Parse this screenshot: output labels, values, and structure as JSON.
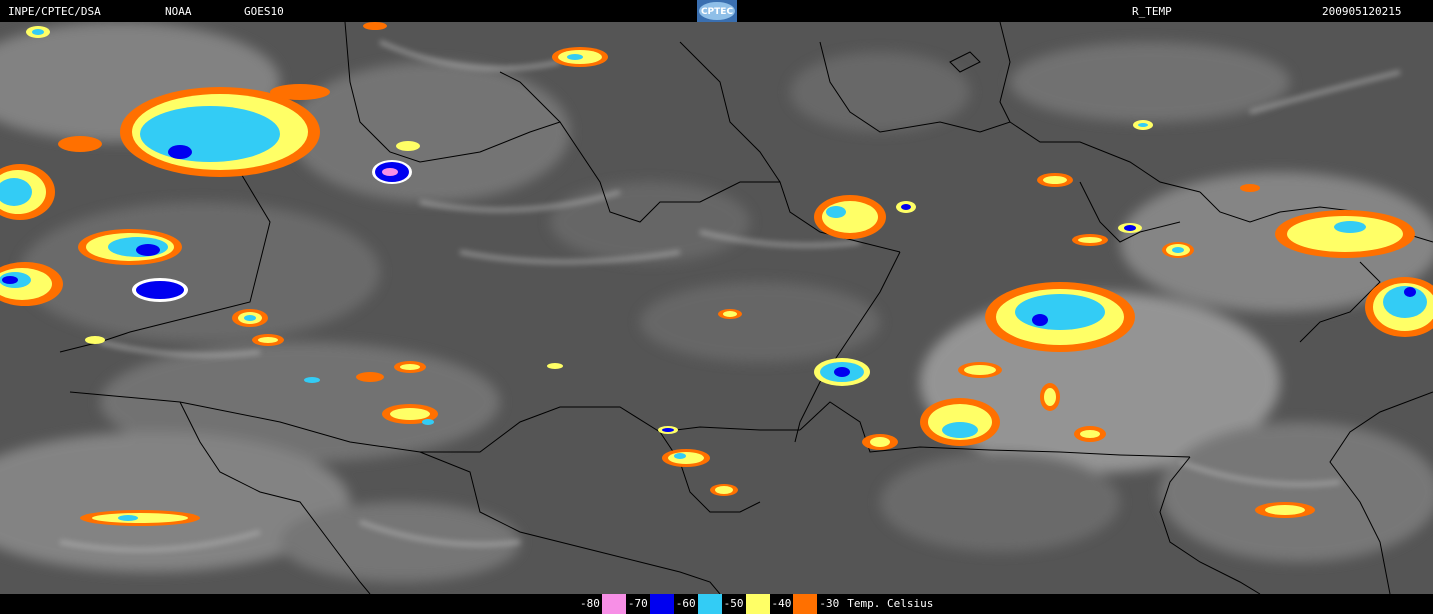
{
  "header": {
    "source": "INPE/CPTEC/DSA",
    "agency": "NOAA",
    "satellite": "GOES10",
    "logo_text": "CPTEC",
    "product": "R_TEMP",
    "timestamp": "200905120215"
  },
  "colors": {
    "background_cloud": "#5c5c5c",
    "high_cloud": "#cfcfcf",
    "border_line": "#000000",
    "t_minus_80": "#f78fe6",
    "t_minus_70": "#0000f0",
    "t_minus_60": "#33ccf5",
    "t_minus_50": "#ffff66",
    "t_minus_40": "#ff7000"
  },
  "legend": {
    "labels": [
      "-80",
      "-70",
      "-60",
      "-50",
      "-40",
      "-30"
    ],
    "unit": "Temp. Celsius"
  }
}
